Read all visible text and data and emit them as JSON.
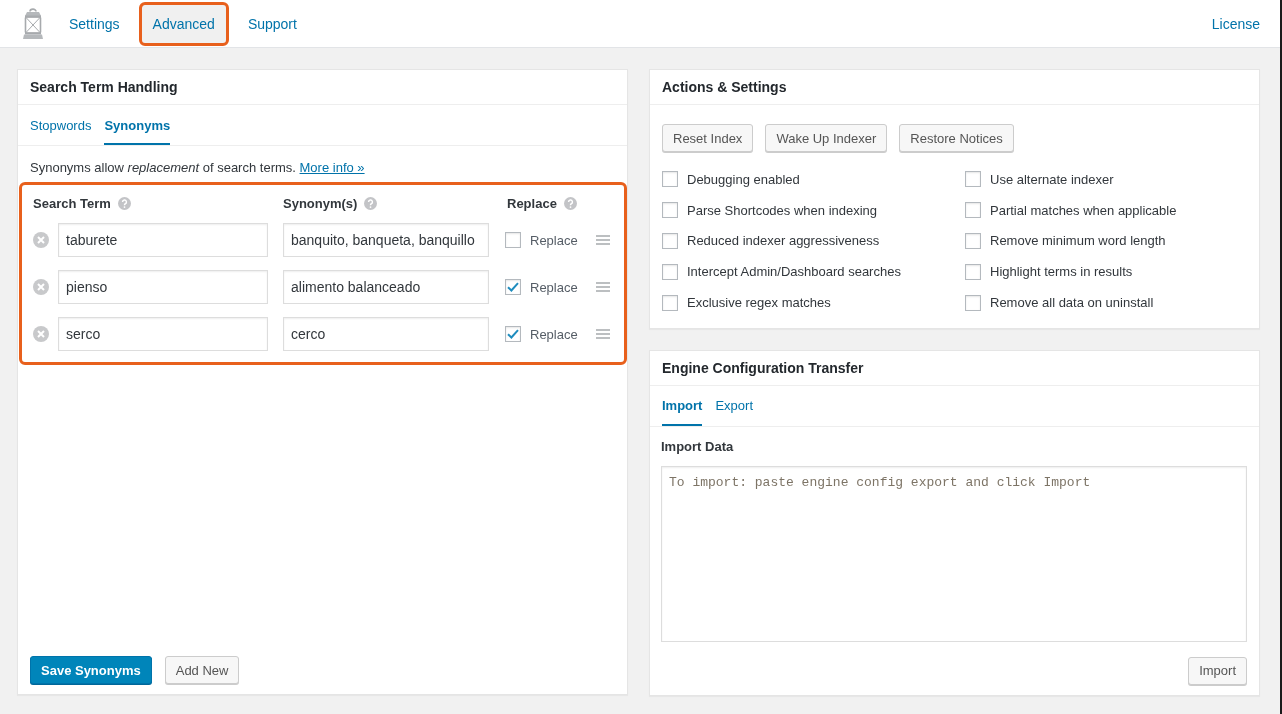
{
  "top_bar": {
    "nav_tabs": [
      {
        "label": "Settings",
        "selected": false,
        "highlighted": false
      },
      {
        "label": "Advanced",
        "selected": true,
        "highlighted": true
      },
      {
        "label": "Support",
        "selected": false,
        "highlighted": false
      }
    ],
    "license_link": "License"
  },
  "search_term_handling": {
    "title": "Search Term Handling",
    "tabs": [
      {
        "label": "Stopwords",
        "selected": false
      },
      {
        "label": "Synonyms",
        "selected": true
      }
    ],
    "description": "Synonyms allow *replacement* of search terms.",
    "more_info_link": "More info »",
    "synonyms_table": {
      "highlighted": true,
      "columns": [
        "Search Term",
        "Synonym(s)",
        "Replace"
      ],
      "rows": [
        {
          "search_term": "taburete",
          "synonyms": "banquito, banqueta, banquillo",
          "replace": {
            "label": "Replace",
            "checked": false
          }
        },
        {
          "search_term": "pienso",
          "synonyms": "alimento balanceado",
          "replace": {
            "label": "Replace",
            "checked": true
          }
        },
        {
          "search_term": "serco",
          "synonyms": "cerco",
          "replace": {
            "label": "Replace",
            "checked": true
          }
        }
      ]
    },
    "buttons": [
      {
        "label": "Save Synonyms",
        "kind": "primary"
      },
      {
        "label": "Add New",
        "kind": "secondary"
      }
    ]
  },
  "actions_settings": {
    "title": "Actions & Settings",
    "buttons": [
      "Reset Index",
      "Wake Up Indexer",
      "Restore Notices"
    ],
    "options": [
      {
        "label": "Debugging enabled",
        "checked": false
      },
      {
        "label": "Use alternate indexer",
        "checked": false
      },
      {
        "label": "Parse Shortcodes when indexing",
        "checked": false
      },
      {
        "label": "Partial matches when applicable",
        "checked": false
      },
      {
        "label": "Reduced indexer aggressiveness",
        "checked": false
      },
      {
        "label": "Remove minimum word length",
        "checked": false
      },
      {
        "label": "Intercept Admin/Dashboard searches",
        "checked": false
      },
      {
        "label": "Highlight terms in results",
        "checked": false
      },
      {
        "label": "Exclusive regex matches",
        "checked": false
      },
      {
        "label": "Remove all data on uninstall",
        "checked": false
      }
    ]
  },
  "engine_configuration_transfer": {
    "title": "Engine Configuration Transfer",
    "tabs": [
      {
        "label": "Import",
        "selected": true
      },
      {
        "label": "Export",
        "selected": false
      }
    ],
    "field_label": "Import Data",
    "import_field": {
      "placeholder": "To import: paste engine config export and click Import"
    },
    "button": "Import"
  }
}
